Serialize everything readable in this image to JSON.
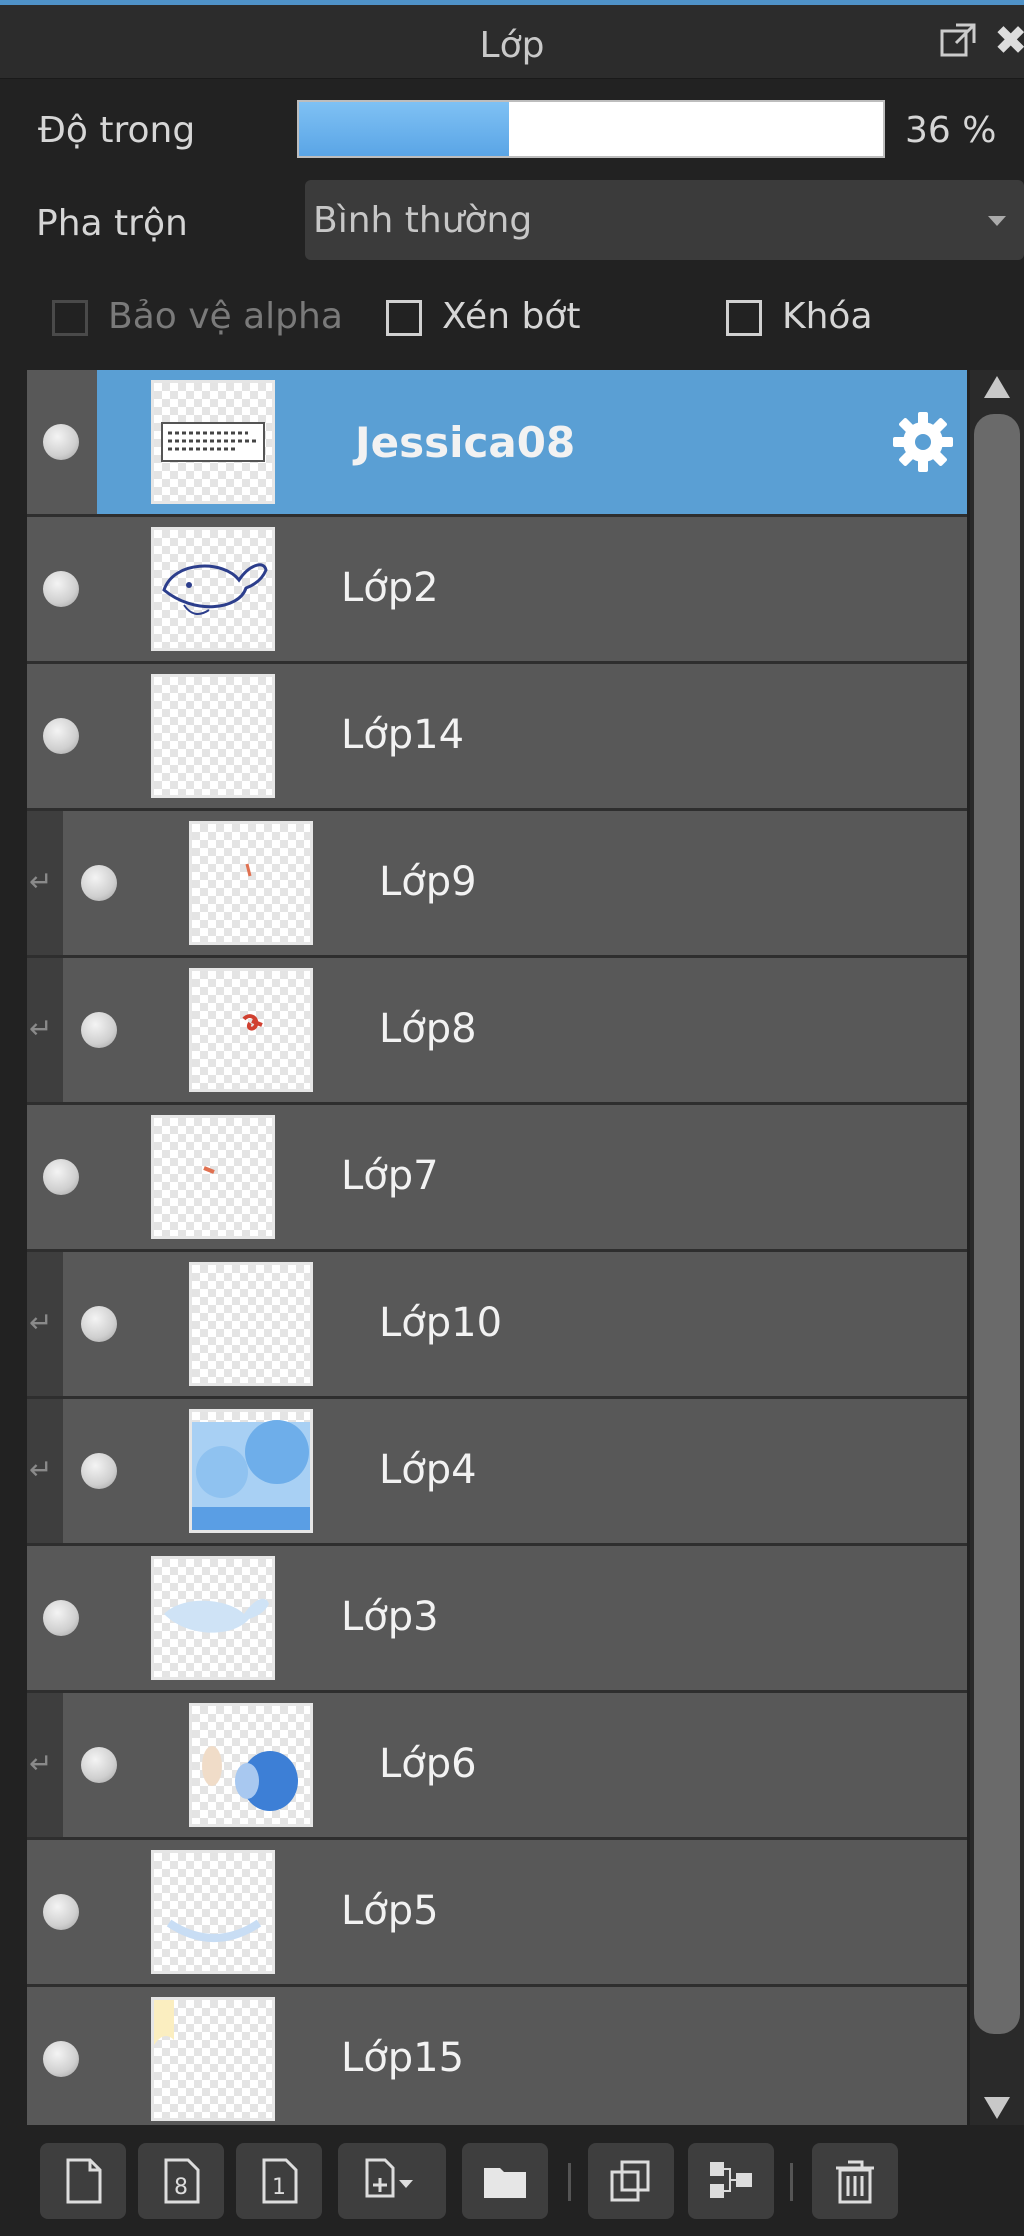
{
  "panel": {
    "title": "Lớp"
  },
  "opacity": {
    "label": "Độ trong",
    "value_pct": 36,
    "display": "36 %"
  },
  "blend": {
    "label": "Pha trộn",
    "value": "Bình thường"
  },
  "options": [
    {
      "label": "Bảo vệ alpha",
      "checked": false,
      "enabled": false
    },
    {
      "label": "Xén bớt",
      "checked": false,
      "enabled": true
    },
    {
      "label": "Khóa",
      "checked": false,
      "enabled": true
    }
  ],
  "layers": [
    {
      "name": "Jessica08",
      "selected": true,
      "clipped": false,
      "thumb": "text"
    },
    {
      "name": "Lớp2",
      "selected": false,
      "clipped": false,
      "thumb": "whale-lineart"
    },
    {
      "name": "Lớp14",
      "selected": false,
      "clipped": false,
      "thumb": "empty"
    },
    {
      "name": "Lớp9",
      "selected": false,
      "clipped": true,
      "thumb": "red-mark-small"
    },
    {
      "name": "Lớp8",
      "selected": false,
      "clipped": true,
      "thumb": "red-mark"
    },
    {
      "name": "Lớp7",
      "selected": false,
      "clipped": false,
      "thumb": "red-mark-tiny"
    },
    {
      "name": "Lớp10",
      "selected": false,
      "clipped": true,
      "thumb": "empty"
    },
    {
      "name": "Lớp4",
      "selected": false,
      "clipped": true,
      "thumb": "blue-fill"
    },
    {
      "name": "Lớp3",
      "selected": false,
      "clipped": false,
      "thumb": "light-blue-whale"
    },
    {
      "name": "Lớp6",
      "selected": false,
      "clipped": true,
      "thumb": "blue-blob"
    },
    {
      "name": "Lớp5",
      "selected": false,
      "clipped": false,
      "thumb": "blue-curve"
    },
    {
      "name": "Lớp15",
      "selected": false,
      "clipped": false,
      "thumb": "yellow-corner"
    }
  ],
  "toolbar": [
    {
      "icon": "new-layer-icon"
    },
    {
      "icon": "new-8bit-layer-icon"
    },
    {
      "icon": "new-1bit-layer-icon"
    },
    {
      "icon": "add-layer-menu-icon"
    },
    {
      "icon": "folder-icon"
    },
    {
      "icon": "duplicate-layer-icon"
    },
    {
      "icon": "merge-layer-icon"
    },
    {
      "icon": "trash-icon"
    }
  ],
  "colors": {
    "selected": "#5a9fd4",
    "row": "#585858",
    "accent": "#4f92c8"
  }
}
